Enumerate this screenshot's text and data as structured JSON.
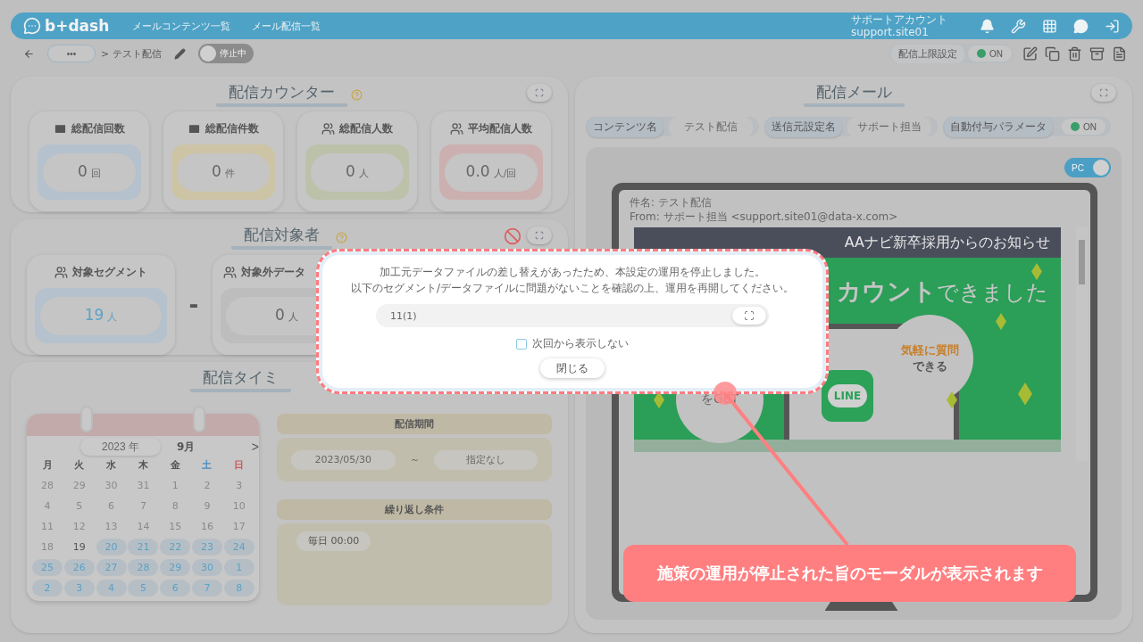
{
  "header": {
    "logo": "b+dash",
    "nav": [
      {
        "label": "メールコンテンツ一覧"
      },
      {
        "label": "メール配信一覧"
      }
    ],
    "account": {
      "name": "サポートアカウント",
      "site": "support.site01"
    }
  },
  "toolbar": {
    "more": "•••",
    "breadcrumb": "> テスト配信",
    "status_toggle": {
      "label": "停止中",
      "on": false
    },
    "limit": {
      "label": "配信上限設定",
      "value": "ON",
      "on": true
    }
  },
  "counter": {
    "title": "配信カウンター",
    "cards": [
      {
        "label": "総配信回数",
        "value": "0",
        "unit": "回",
        "color": "#b5c1cc"
      },
      {
        "label": "総配信件数",
        "value": "0",
        "unit": "件",
        "color": "#cdc4a6"
      },
      {
        "label": "総配信人数",
        "value": "0",
        "unit": "人",
        "color": "#bcc1a9"
      },
      {
        "label": "平均配信人数",
        "value": "0.0",
        "unit": "人/回",
        "color": "#ccb0b0"
      }
    ]
  },
  "target": {
    "title": "配信対象者",
    "segment": {
      "label": "対象セグメント",
      "value": "19",
      "unit": "人"
    },
    "operator": "-",
    "excluded": {
      "label": "対象外データ",
      "value": "0",
      "unit": "人"
    }
  },
  "timing": {
    "title": "配信タイミ",
    "calendar": {
      "year": "2023",
      "year_unit": "年",
      "month": "9月",
      "next": ">",
      "weekdays": [
        {
          "label": "月",
          "kind": "weekday"
        },
        {
          "label": "火",
          "kind": "weekday"
        },
        {
          "label": "水",
          "kind": "weekday"
        },
        {
          "label": "木",
          "kind": "weekday"
        },
        {
          "label": "金",
          "kind": "weekday"
        },
        {
          "label": "土",
          "kind": "sat"
        },
        {
          "label": "日",
          "kind": "sun"
        }
      ],
      "weeks": [
        [
          {
            "day": "28",
            "kind": "other"
          },
          {
            "day": "29",
            "kind": "other"
          },
          {
            "day": "30",
            "kind": "other"
          },
          {
            "day": "31",
            "kind": "other"
          },
          {
            "day": "1",
            "kind": "other"
          },
          {
            "day": "2",
            "kind": "other"
          },
          {
            "day": "3",
            "kind": "other"
          }
        ],
        [
          {
            "day": "4",
            "kind": "other"
          },
          {
            "day": "5",
            "kind": "other"
          },
          {
            "day": "6",
            "kind": "other"
          },
          {
            "day": "7",
            "kind": "other"
          },
          {
            "day": "8",
            "kind": "other"
          },
          {
            "day": "9",
            "kind": "other"
          },
          {
            "day": "10",
            "kind": "other"
          }
        ],
        [
          {
            "day": "11",
            "kind": "other"
          },
          {
            "day": "12",
            "kind": "other"
          },
          {
            "day": "13",
            "kind": "other"
          },
          {
            "day": "14",
            "kind": "other"
          },
          {
            "day": "15",
            "kind": "other"
          },
          {
            "day": "16",
            "kind": "other"
          },
          {
            "day": "17",
            "kind": "other"
          }
        ],
        [
          {
            "day": "18",
            "kind": "other"
          },
          {
            "day": "19",
            "kind": "today"
          },
          {
            "day": "20",
            "kind": "scheduled"
          },
          {
            "day": "21",
            "kind": "scheduled"
          },
          {
            "day": "22",
            "kind": "scheduled"
          },
          {
            "day": "23",
            "kind": "scheduled"
          },
          {
            "day": "24",
            "kind": "scheduled"
          }
        ],
        [
          {
            "day": "25",
            "kind": "scheduled"
          },
          {
            "day": "26",
            "kind": "scheduled"
          },
          {
            "day": "27",
            "kind": "scheduled"
          },
          {
            "day": "28",
            "kind": "scheduled"
          },
          {
            "day": "29",
            "kind": "scheduled"
          },
          {
            "day": "30",
            "kind": "scheduled"
          },
          {
            "day": "1",
            "kind": "scheduled"
          }
        ],
        [
          {
            "day": "2",
            "kind": "scheduled"
          },
          {
            "day": "3",
            "kind": "scheduled"
          },
          {
            "day": "4",
            "kind": "scheduled"
          },
          {
            "day": "5",
            "kind": "scheduled"
          },
          {
            "day": "6",
            "kind": "scheduled"
          },
          {
            "day": "7",
            "kind": "scheduled"
          },
          {
            "day": "8",
            "kind": "scheduled"
          }
        ]
      ]
    },
    "period": {
      "title": "配信期間",
      "start": "2023/05/30",
      "separator": "～",
      "end": "指定なし"
    },
    "repeat": {
      "title": "繰り返し条件",
      "items": [
        "毎日 00:00"
      ]
    }
  },
  "mail": {
    "title": "配信メール",
    "fields": [
      {
        "label": "コンテンツ名",
        "kind": "text",
        "value": "テスト配信"
      },
      {
        "label": "送信元設定名",
        "kind": "text",
        "value": "サポート担当"
      },
      {
        "label": "自動付与パラメータ",
        "kind": "toggle",
        "value": "ON",
        "on": true
      }
    ],
    "view_toggle": {
      "label": "PC",
      "on": true
    },
    "preview": {
      "subject": "件名: テスト配信",
      "from": "From: サポート担当 <support.site01@data-x.com>",
      "banner_title": "AAナビ新卒採用からのお知らせ",
      "headline": "**カウント**できました",
      "bubble_lines": [
        "気軽に質問",
        "できる"
      ],
      "app_label": "LINE",
      "get_text": "をGET"
    }
  },
  "modal": {
    "lines": [
      "加工元データファイルの差し替えがあったため、本設定の運用を停止しました。",
      "以下のセグメント/データファイルに問題がないことを確認の上、運用を再開してください。"
    ],
    "segment": "11(1)",
    "dont_show": {
      "label": "次回から表示しない",
      "checked": false
    },
    "close": "閉じる"
  },
  "callout": "施策の運用が停止された旨のモーダルが表示されます"
}
